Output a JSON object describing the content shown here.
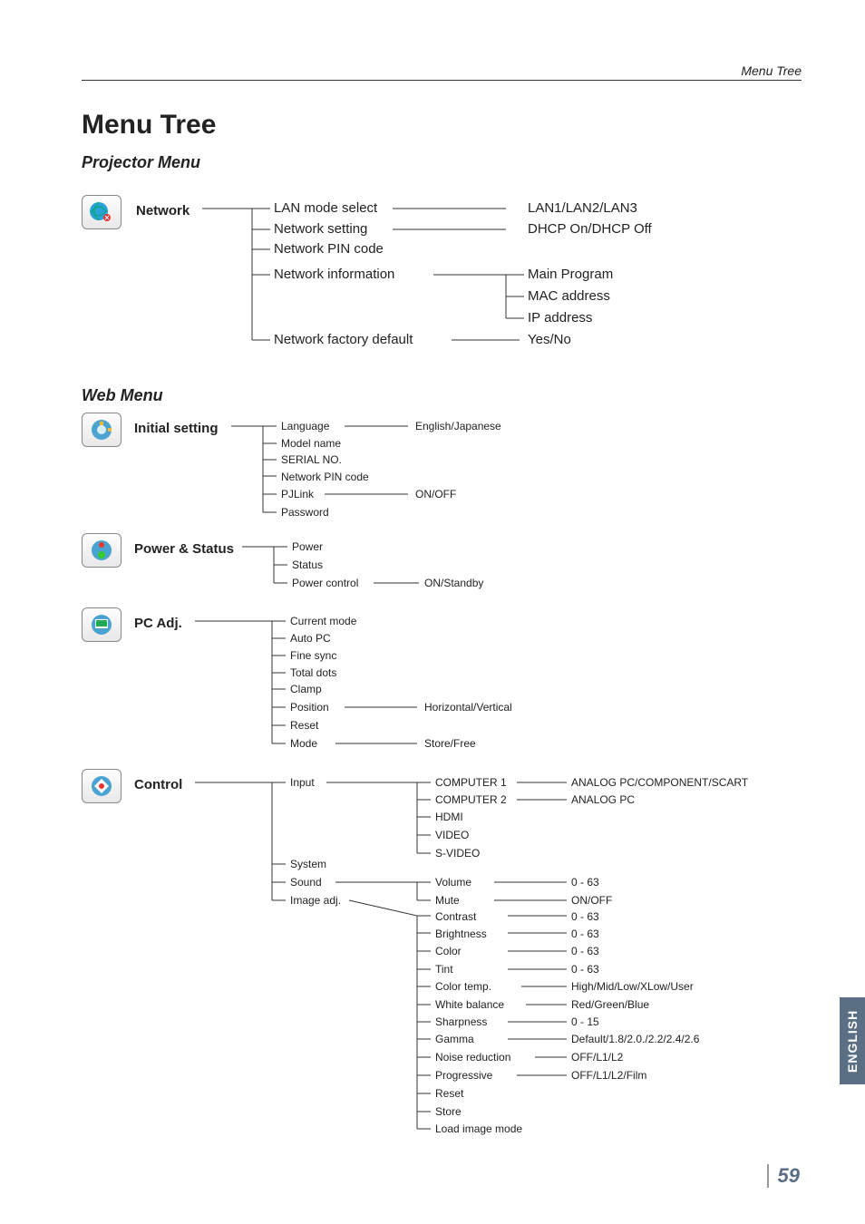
{
  "header": {
    "breadcrumb": "Menu Tree",
    "title": "Menu Tree"
  },
  "sections": {
    "projector": "Projector Menu",
    "web": "Web Menu"
  },
  "network": {
    "label": "Network",
    "items": [
      "LAN mode select",
      "Network setting",
      "Network PIN code",
      "Network information",
      "Network factory default"
    ],
    "lan_mode_values": "LAN1/LAN2/LAN3",
    "net_setting_values": "DHCP On/DHCP Off",
    "net_info_children": [
      "Main Program",
      "MAC address",
      "IP address"
    ],
    "factory_default_values": "Yes/No"
  },
  "initial": {
    "label": "Initial setting",
    "items": [
      "Language",
      "Model name",
      "SERIAL NO.",
      "Network PIN code",
      "PJLink",
      "Password"
    ],
    "language_values": "English/Japanese",
    "pjlink_values": "ON/OFF"
  },
  "power": {
    "label": "Power & Status",
    "items": [
      "Power",
      "Status",
      "Power control"
    ],
    "power_control_values": "ON/Standby"
  },
  "pcadj": {
    "label": "PC Adj.",
    "items": [
      "Current mode",
      "Auto PC",
      "Fine sync",
      "Total dots",
      "Clamp",
      "Position",
      "Reset",
      "Mode"
    ],
    "position_values": "Horizontal/Vertical",
    "mode_values": "Store/Free"
  },
  "control": {
    "label": "Control",
    "top_items": [
      "Input",
      "System",
      "Sound",
      "Image adj."
    ],
    "input_children": [
      "COMPUTER 1",
      "COMPUTER 2",
      "HDMI",
      "VIDEO",
      "S-VIDEO"
    ],
    "computer1_values": "ANALOG PC/COMPONENT/SCART",
    "computer2_values": "ANALOG PC",
    "sound_children": [
      "Volume",
      "Mute"
    ],
    "volume_values": "0 - 63",
    "mute_values": "ON/OFF",
    "image_children": [
      "Contrast",
      "Brightness",
      "Color",
      "Tint",
      "Color temp.",
      "White balance",
      "Sharpness",
      "Gamma",
      "Noise reduction",
      "Progressive",
      "Reset",
      "Store",
      "Load image mode"
    ],
    "image_values": {
      "contrast": "0 - 63",
      "brightness": "0 - 63",
      "color": "0 - 63",
      "tint": "0 - 63",
      "color_temp": "High/Mid/Low/XLow/User",
      "white_balance": "Red/Green/Blue",
      "sharpness": "0 - 15",
      "gamma": "Default/1.8/2.0./2.2/2.4/2.6",
      "noise_reduction": "OFF/L1/L2",
      "progressive": "OFF/L1/L2/Film"
    }
  },
  "side_tab": "ENGLISH",
  "page_number": "59"
}
